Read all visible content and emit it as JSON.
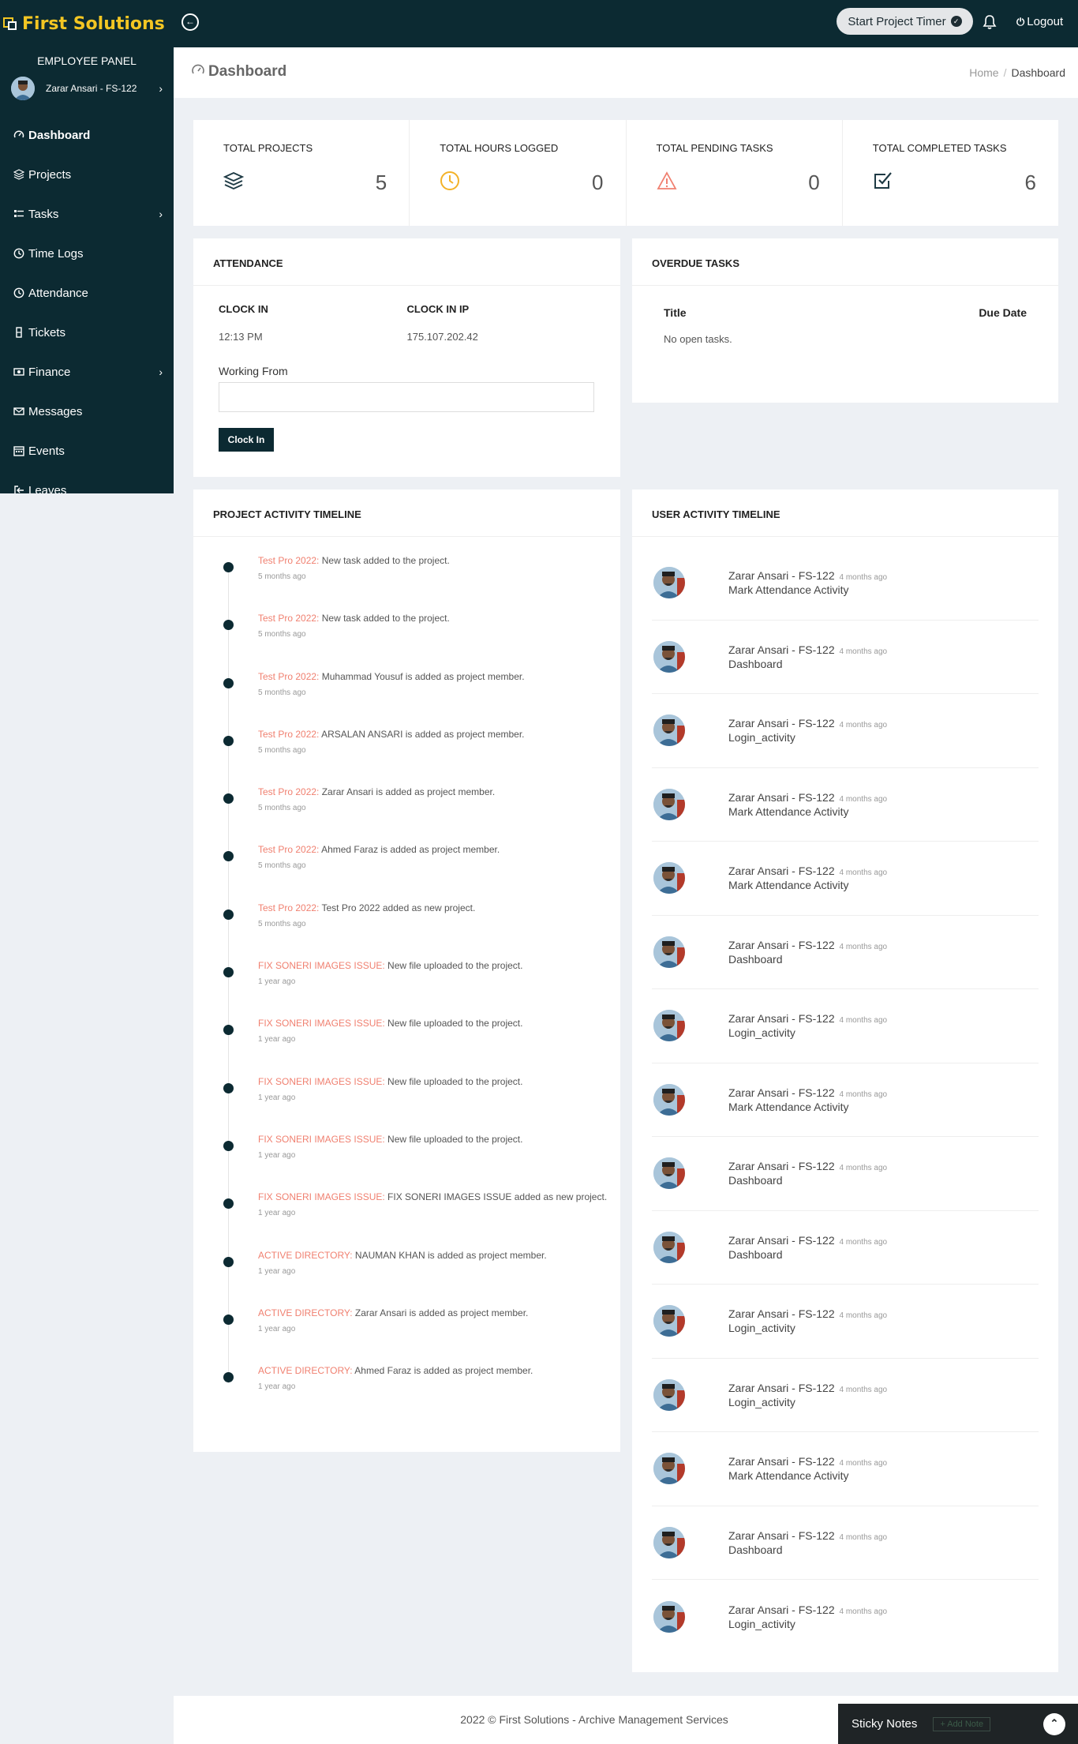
{
  "app": {
    "brand": "First Solutions"
  },
  "header": {
    "timer_label": "Start Project Timer",
    "logout_label": "Logout"
  },
  "sidebar": {
    "panel_title": "EMPLOYEE PANEL",
    "user_name": "Zarar Ansari - FS-122",
    "items": [
      {
        "label": "Dashboard",
        "icon": "gauge-icon",
        "active": true
      },
      {
        "label": "Projects",
        "icon": "layers-icon"
      },
      {
        "label": "Tasks",
        "icon": "list-icon",
        "submenu": true
      },
      {
        "label": "Time Logs",
        "icon": "clock-icon"
      },
      {
        "label": "Attendance",
        "icon": "clock-icon"
      },
      {
        "label": "Tickets",
        "icon": "ticket-icon"
      },
      {
        "label": "Finance",
        "icon": "money-icon",
        "submenu": true
      },
      {
        "label": "Messages",
        "icon": "envelope-icon"
      },
      {
        "label": "Events",
        "icon": "calendar-icon"
      },
      {
        "label": "Leaves",
        "icon": "sign-out-icon"
      }
    ]
  },
  "page": {
    "title": "Dashboard",
    "breadcrumb_home": "Home",
    "breadcrumb_current": "Dashboard"
  },
  "stats": [
    {
      "label": "TOTAL PROJECTS",
      "value": "5",
      "icon": "layers-icon",
      "color": "#1e3a44"
    },
    {
      "label": "TOTAL HOURS LOGGED",
      "value": "0",
      "icon": "clock-icon",
      "color": "#f3b228"
    },
    {
      "label": "TOTAL PENDING TASKS",
      "value": "0",
      "icon": "warning-icon",
      "color": "#f08070"
    },
    {
      "label": "TOTAL COMPLETED TASKS",
      "value": "6",
      "icon": "checkbox-icon",
      "color": "#1e3a44"
    }
  ],
  "attendance": {
    "title": "ATTENDANCE",
    "clock_in_label": "CLOCK IN",
    "clock_in_value": "12:13 PM",
    "clock_in_ip_label": "CLOCK IN IP",
    "clock_in_ip_value": "175.107.202.42",
    "working_from_label": "Working From",
    "working_from_value": "",
    "button_label": "Clock In"
  },
  "overdue": {
    "title": "OVERDUE TASKS",
    "col_title": "Title",
    "col_due": "Due Date",
    "empty_text": "No open tasks."
  },
  "project_timeline": {
    "title": "PROJECT ACTIVITY TIMELINE",
    "items": [
      {
        "project": "Test Pro 2022:",
        "text": " New task added to the project.",
        "time": "5 months ago"
      },
      {
        "project": "Test Pro 2022:",
        "text": " New task added to the project.",
        "time": "5 months ago"
      },
      {
        "project": "Test Pro 2022:",
        "text": " Muhammad Yousuf is added as project member.",
        "time": "5 months ago"
      },
      {
        "project": "Test Pro 2022:",
        "text": " ARSALAN ANSARI is added as project member.",
        "time": "5 months ago"
      },
      {
        "project": "Test Pro 2022:",
        "text": " Zarar Ansari is added as project member.",
        "time": "5 months ago"
      },
      {
        "project": "Test Pro 2022:",
        "text": " Ahmed Faraz is added as project member.",
        "time": "5 months ago"
      },
      {
        "project": "Test Pro 2022:",
        "text": " Test Pro 2022 added as new project.",
        "time": "5 months ago"
      },
      {
        "project": "FIX SONERI IMAGES ISSUE:",
        "text": " New file uploaded to the project.",
        "time": "1 year ago"
      },
      {
        "project": "FIX SONERI IMAGES ISSUE:",
        "text": " New file uploaded to the project.",
        "time": "1 year ago"
      },
      {
        "project": "FIX SONERI IMAGES ISSUE:",
        "text": " New file uploaded to the project.",
        "time": "1 year ago"
      },
      {
        "project": "FIX SONERI IMAGES ISSUE:",
        "text": " New file uploaded to the project.",
        "time": "1 year ago"
      },
      {
        "project": "FIX SONERI IMAGES ISSUE:",
        "text": " FIX SONERI IMAGES ISSUE added as new project.",
        "time": "1 year ago"
      },
      {
        "project": "ACTIVE DIRECTORY:",
        "text": " NAUMAN KHAN is added as project member.",
        "time": "1 year ago"
      },
      {
        "project": "ACTIVE DIRECTORY:",
        "text": " Zarar Ansari is added as project member.",
        "time": "1 year ago"
      },
      {
        "project": "ACTIVE DIRECTORY:",
        "text": " Ahmed Faraz is added as project member.",
        "time": "1 year ago"
      }
    ]
  },
  "user_timeline": {
    "title": "USER ACTIVITY TIMELINE",
    "items": [
      {
        "name": "Zarar Ansari - FS-122",
        "time": "4 months ago",
        "activity": "Mark Attendance Activity"
      },
      {
        "name": "Zarar Ansari - FS-122",
        "time": "4 months ago",
        "activity": "Dashboard"
      },
      {
        "name": "Zarar Ansari - FS-122",
        "time": "4 months ago",
        "activity": "Login_activity"
      },
      {
        "name": "Zarar Ansari - FS-122",
        "time": "4 months ago",
        "activity": "Mark Attendance Activity"
      },
      {
        "name": "Zarar Ansari - FS-122",
        "time": "4 months ago",
        "activity": "Mark Attendance Activity"
      },
      {
        "name": "Zarar Ansari - FS-122",
        "time": "4 months ago",
        "activity": "Dashboard"
      },
      {
        "name": "Zarar Ansari - FS-122",
        "time": "4 months ago",
        "activity": "Login_activity"
      },
      {
        "name": "Zarar Ansari - FS-122",
        "time": "4 months ago",
        "activity": "Mark Attendance Activity"
      },
      {
        "name": "Zarar Ansari - FS-122",
        "time": "4 months ago",
        "activity": "Dashboard"
      },
      {
        "name": "Zarar Ansari - FS-122",
        "time": "4 months ago",
        "activity": "Dashboard"
      },
      {
        "name": "Zarar Ansari - FS-122",
        "time": "4 months ago",
        "activity": "Login_activity"
      },
      {
        "name": "Zarar Ansari - FS-122",
        "time": "4 months ago",
        "activity": "Login_activity"
      },
      {
        "name": "Zarar Ansari - FS-122",
        "time": "4 months ago",
        "activity": "Mark Attendance Activity"
      },
      {
        "name": "Zarar Ansari - FS-122",
        "time": "4 months ago",
        "activity": "Dashboard"
      },
      {
        "name": "Zarar Ansari - FS-122",
        "time": "4 months ago",
        "activity": "Login_activity"
      }
    ]
  },
  "footer": {
    "text": "2022 © First Solutions - Archive Management Services"
  },
  "sticky_notes": {
    "title": "Sticky Notes",
    "add_label": "+ Add Note"
  }
}
